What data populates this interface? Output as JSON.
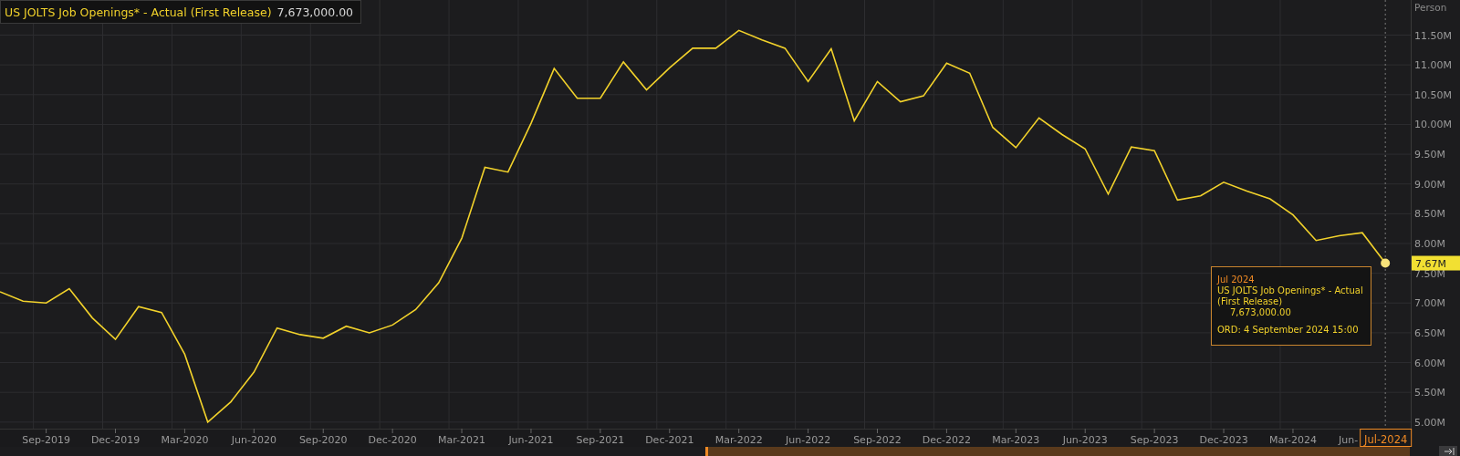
{
  "legend": {
    "value": "7,673,000.00"
  },
  "chart_data": {
    "type": "line",
    "ylabel": "Person",
    "grid": true,
    "categories": [
      null,
      null,
      "Sep-2019",
      null,
      null,
      "Dec-2019",
      null,
      null,
      "Mar-2020",
      null,
      null,
      "Jun-2020",
      null,
      null,
      "Sep-2020",
      null,
      null,
      "Dec-2020",
      null,
      null,
      "Mar-2021",
      null,
      null,
      "Jun-2021",
      null,
      null,
      "Sep-2021",
      null,
      null,
      "Dec-2021",
      null,
      null,
      "Mar-2022",
      null,
      null,
      "Jun-2022",
      null,
      null,
      "Sep-2022",
      null,
      null,
      "Dec-2022",
      null,
      null,
      "Mar-2023",
      null,
      null,
      "Jun-2023",
      null,
      null,
      "Sep-2023",
      null,
      null,
      "Dec-2023",
      null,
      null,
      "Mar-2024",
      null,
      null,
      null,
      "Jul-2024"
    ],
    "series": [
      {
        "name": "US JOLTS Job Openings* - Actual (First Release)",
        "color": "#f2d22b",
        "values": [
          7.19,
          7.03,
          7.0,
          7.24,
          6.75,
          6.39,
          6.94,
          6.84,
          6.14,
          5.0,
          5.34,
          5.84,
          6.58,
          6.47,
          6.41,
          6.61,
          6.5,
          6.63,
          6.89,
          7.34,
          8.09,
          9.28,
          9.2,
          10.02,
          10.94,
          10.44,
          10.44,
          11.05,
          10.58,
          10.95,
          11.28,
          11.28,
          11.58,
          11.42,
          11.28,
          10.72,
          11.27,
          10.06,
          10.72,
          10.38,
          10.48,
          11.03,
          10.86,
          9.95,
          9.61,
          10.11,
          9.83,
          9.59,
          8.83,
          9.62,
          9.56,
          8.73,
          8.8,
          9.03,
          8.88,
          8.75,
          8.48,
          8.05,
          8.13,
          8.18,
          7.67
        ]
      }
    ],
    "ylim": [
      4.89,
      12.09
    ],
    "yticks": [
      {
        "value": 5.0,
        "label": "5.00M"
      },
      {
        "value": 5.5,
        "label": "5.50M"
      },
      {
        "value": 6.0,
        "label": "6.00M"
      },
      {
        "value": 6.5,
        "label": "6.50M"
      },
      {
        "value": 7.0,
        "label": "7.00M"
      },
      {
        "value": 7.5,
        "label": "7.50M"
      },
      {
        "value": 8.0,
        "label": "8.00M"
      },
      {
        "value": 8.5,
        "label": "8.50M"
      },
      {
        "value": 9.0,
        "label": "9.00M"
      },
      {
        "value": 9.5,
        "label": "9.50M"
      },
      {
        "value": 10.0,
        "label": "10.00M"
      },
      {
        "value": 10.5,
        "label": "10.50M"
      },
      {
        "value": 11.0,
        "label": "11.00M"
      },
      {
        "value": 11.5,
        "label": "11.50M"
      }
    ],
    "stacked": false
  },
  "cursor": {
    "value_label": "7.67M",
    "covered_tick_label": "Jun-"
  },
  "tooltip": {
    "date": "Jul 2024",
    "series": "US JOLTS Job Openings* - Actual (First Release)",
    "value": "7,673,000.00",
    "release": "ORD: 4 September 2024 15:00"
  }
}
